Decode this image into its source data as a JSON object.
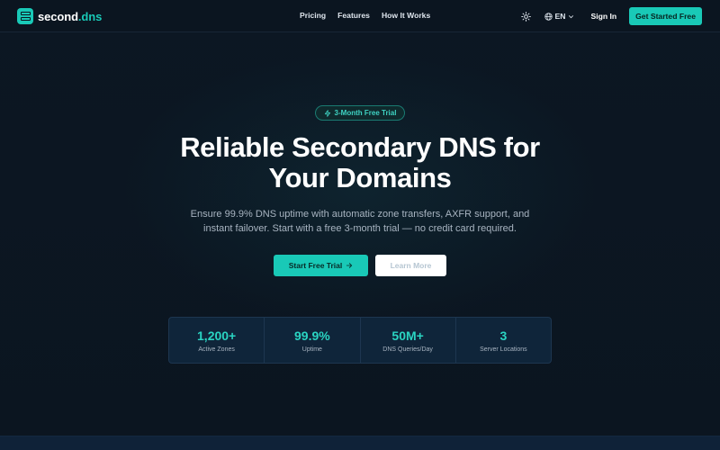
{
  "brand": {
    "name_main": "second",
    "name_accent": ".dns",
    "logo_icon": "server-stack-icon"
  },
  "nav": {
    "links": [
      {
        "label": "Pricing"
      },
      {
        "label": "Features"
      },
      {
        "label": "How It Works"
      }
    ],
    "theme_icon": "sun-icon",
    "language": "EN",
    "language_icon": "globe-icon",
    "signin_label": "Sign In",
    "cta_label": "Get Started Free"
  },
  "hero": {
    "badge_icon": "lightning-icon",
    "badge": "3-Month Free Trial",
    "title_line1": "Reliable Secondary DNS for",
    "title_line2": "Your Domains",
    "subtitle_line1": "Ensure 99.9% DNS uptime with automatic zone transfers, AXFR support, and",
    "subtitle_line2": "instant failover. Start with a free 3-month trial — no credit card required.",
    "primary_label": "Start Free Trial",
    "primary_icon": "arrow-right-icon",
    "secondary_label": "Learn More"
  },
  "stats": [
    {
      "value": "1,200+",
      "label": "Active Zones"
    },
    {
      "value": "99.9%",
      "label": "Uptime"
    },
    {
      "value": "50M+",
      "label": "DNS Queries/Day"
    },
    {
      "value": "3",
      "label": "Server Locations"
    }
  ],
  "colors": {
    "accent": "#19c9b7",
    "background": "#0b1622",
    "card": "#0f253a"
  }
}
